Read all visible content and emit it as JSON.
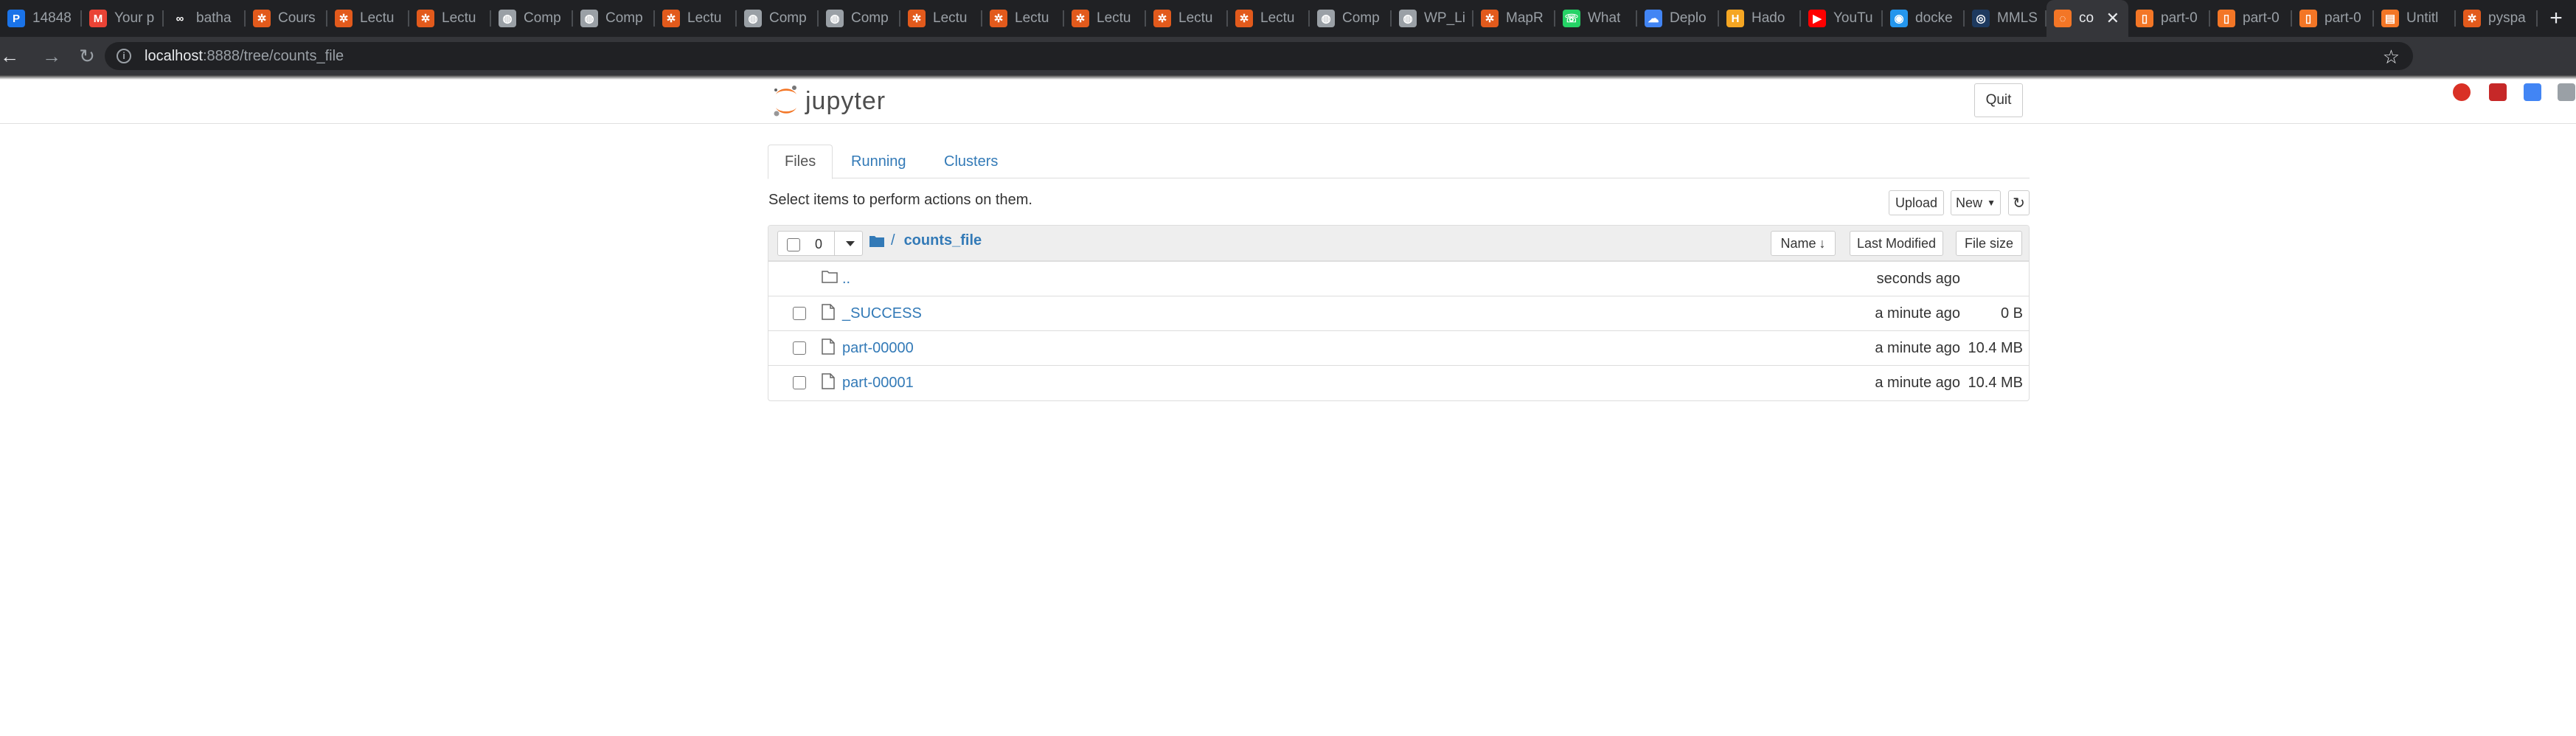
{
  "browser": {
    "tabs": [
      {
        "title": "14848",
        "icon": "p-icon",
        "color": "#1a73e8"
      },
      {
        "title": "Your p",
        "icon": "gmail-icon",
        "color": "#ea4335"
      },
      {
        "title": "batha",
        "icon": "link-icon",
        "color": "#202124"
      },
      {
        "title": "Cours",
        "icon": "spark-icon",
        "color": "#e25a1c"
      },
      {
        "title": "Lectu",
        "icon": "spark-icon",
        "color": "#e25a1c"
      },
      {
        "title": "Lectu",
        "icon": "spark-icon",
        "color": "#e25a1c"
      },
      {
        "title": "Comp",
        "icon": "globe-icon",
        "color": "#9aa0a6"
      },
      {
        "title": "Comp",
        "icon": "globe-icon",
        "color": "#9aa0a6"
      },
      {
        "title": "Lectu",
        "icon": "spark-icon",
        "color": "#e25a1c"
      },
      {
        "title": "Comp",
        "icon": "globe-icon",
        "color": "#9aa0a6"
      },
      {
        "title": "Comp",
        "icon": "globe-icon",
        "color": "#9aa0a6"
      },
      {
        "title": "Lectu",
        "icon": "spark-icon",
        "color": "#e25a1c"
      },
      {
        "title": "Lectu",
        "icon": "spark-icon",
        "color": "#e25a1c"
      },
      {
        "title": "Lectu",
        "icon": "spark-icon",
        "color": "#e25a1c"
      },
      {
        "title": "Lectu",
        "icon": "spark-icon",
        "color": "#e25a1c"
      },
      {
        "title": "Lectu",
        "icon": "spark-icon",
        "color": "#e25a1c"
      },
      {
        "title": "Comp",
        "icon": "globe-icon",
        "color": "#9aa0a6"
      },
      {
        "title": "WP_Li",
        "icon": "globe-icon",
        "color": "#9aa0a6"
      },
      {
        "title": "MapR",
        "icon": "spark-icon",
        "color": "#e25a1c"
      },
      {
        "title": "What",
        "icon": "whatsapp-icon",
        "color": "#25d366"
      },
      {
        "title": "Deplo",
        "icon": "gcloud-icon",
        "color": "#4285f4"
      },
      {
        "title": "Hado",
        "icon": "hadoop-icon",
        "color": "#f5a623"
      },
      {
        "title": "YouTu",
        "icon": "youtube-icon",
        "color": "#ff0000"
      },
      {
        "title": "docke",
        "icon": "docker-icon",
        "color": "#2496ed"
      },
      {
        "title": "MMLS",
        "icon": "mmls-icon",
        "color": "#1e3a5f"
      },
      {
        "title": "co",
        "icon": "jupyter-icon",
        "color": "#f37626",
        "active": true
      },
      {
        "title": "part-0",
        "icon": "file-icon",
        "color": "#f37626"
      },
      {
        "title": "part-0",
        "icon": "file-icon",
        "color": "#f37626"
      },
      {
        "title": "part-0",
        "icon": "file-icon",
        "color": "#f37626"
      },
      {
        "title": "Untitl",
        "icon": "notebook-icon",
        "color": "#f37626"
      },
      {
        "title": "pyspa",
        "icon": "spark-icon",
        "color": "#e25a1c"
      }
    ],
    "url_host": "localhost",
    "url_rest": ":8888/tree/counts_file"
  },
  "jupyter": {
    "logo_text": "jupyter",
    "quit_label": "Quit",
    "tabs": [
      "Files",
      "Running",
      "Clusters"
    ],
    "hint": "Select items to perform actions on them.",
    "upload_label": "Upload",
    "new_label": "New",
    "selected_count": "0",
    "breadcrumb_root": "/",
    "breadcrumb_current": "counts_file",
    "col_name": "Name",
    "col_modified": "Last Modified",
    "col_size": "File size",
    "files": [
      {
        "name": "..",
        "modified": "seconds ago",
        "size": "",
        "type": "folder"
      },
      {
        "name": "_SUCCESS",
        "modified": "a minute ago",
        "size": "0 B",
        "type": "file"
      },
      {
        "name": "part-00000",
        "modified": "a minute ago",
        "size": "10.4 MB",
        "type": "file"
      },
      {
        "name": "part-00001",
        "modified": "a minute ago",
        "size": "10.4 MB",
        "type": "file"
      }
    ]
  }
}
